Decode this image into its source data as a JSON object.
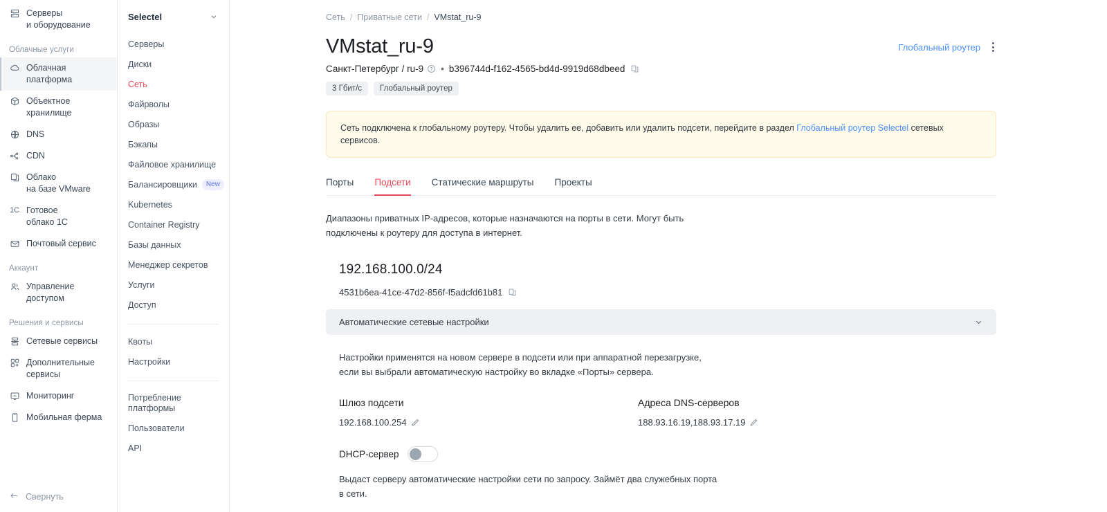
{
  "sidebar_left": {
    "top_items": [
      {
        "label": "Серверы\nи оборудование",
        "icon": "servers-icon"
      }
    ],
    "sections": [
      {
        "title": "Облачные услуги",
        "items": [
          {
            "label": "Облачная\nплатформа",
            "icon": "cloud-icon",
            "active": true
          },
          {
            "label": "Объектное\nхранилище",
            "icon": "box-icon",
            "active": false
          },
          {
            "label": "DNS",
            "icon": "globe-icon",
            "active": false
          },
          {
            "label": "CDN",
            "icon": "cdn-icon",
            "active": false
          },
          {
            "label": "Облако\nна базе VMware",
            "icon": "copy-layers-icon",
            "active": false
          },
          {
            "label": "Готовое\nоблако 1С",
            "icon": "1c-icon",
            "active": false
          },
          {
            "label": "Почтовый сервис",
            "icon": "mail-icon",
            "active": false
          }
        ]
      },
      {
        "title": "Аккаунт",
        "items": [
          {
            "label": "Управление\nдоступом",
            "icon": "users-icon",
            "active": false
          }
        ]
      },
      {
        "title": "Решения и сервисы",
        "items": [
          {
            "label": "Сетевые сервисы",
            "icon": "network-icon",
            "active": false
          },
          {
            "label": "Дополнительные\nсервисы",
            "icon": "grid-plus-icon",
            "active": false
          },
          {
            "label": "Мониторинг",
            "icon": "monitor-icon",
            "active": false
          },
          {
            "label": "Мобильная ферма",
            "icon": "phone-icon",
            "active": false
          }
        ]
      }
    ],
    "collapse_label": "Свернуть",
    "collapse_icon": "arrow-left-icon"
  },
  "sidebar_mid": {
    "project_name": "Selectel",
    "project_chevron_icon": "chevron-down-icon",
    "groups": [
      {
        "items": [
          {
            "label": "Серверы",
            "active": false
          },
          {
            "label": "Диски",
            "active": false
          },
          {
            "label": "Сеть",
            "active": true
          },
          {
            "label": "Файрволы",
            "active": false
          },
          {
            "label": "Образы",
            "active": false
          },
          {
            "label": "Бэкапы",
            "active": false
          },
          {
            "label": "Файловое хранилище",
            "active": false
          },
          {
            "label": "Балансировщики",
            "active": false,
            "badge": "New"
          },
          {
            "label": "Kubernetes",
            "active": false
          },
          {
            "label": "Container Registry",
            "active": false
          },
          {
            "label": "Базы данных",
            "active": false
          },
          {
            "label": "Менеджер секретов",
            "active": false
          },
          {
            "label": "Услуги",
            "active": false
          },
          {
            "label": "Доступ",
            "active": false
          }
        ]
      },
      {
        "items": [
          {
            "label": "Квоты",
            "active": false
          },
          {
            "label": "Настройки",
            "active": false
          }
        ]
      },
      {
        "items": [
          {
            "label": "Потребление\nплатформы",
            "active": false
          },
          {
            "label": "Пользователи",
            "active": false
          },
          {
            "label": "API",
            "active": false
          }
        ]
      }
    ]
  },
  "breadcrumb": {
    "items": [
      "Сеть",
      "Приватные сети",
      "VMstat_ru-9"
    ],
    "separator": "/"
  },
  "header": {
    "title": "VMstat_ru-9",
    "region": "Санкт-Петербург / ru-9",
    "help_icon": "question-circle-icon",
    "bullet": "•",
    "uuid": "b396744d-f162-4565-bd4d-9919d68dbeed",
    "copy_icon": "copy-icon",
    "router_link": "Глобальный роутер",
    "menu_icon": "kebab-menu-icon",
    "chips": [
      "3 Гбит/с",
      "Глобальный роутер"
    ]
  },
  "notice": {
    "text_before": "Сеть подключена к глобальному роутеру. Чтобы удалить ее, добавить или удалить подсети, перейдите в раздел ",
    "link": "Глобальный роутер Selectel",
    "text_after": " сетевых сервисов."
  },
  "tabs": [
    {
      "label": "Порты",
      "active": false
    },
    {
      "label": "Подсети",
      "active": true
    },
    {
      "label": "Статические маршруты",
      "active": false
    },
    {
      "label": "Проекты",
      "active": false
    }
  ],
  "content": {
    "lead": "Диапазоны приватных IP-адресов, которые назначаются на порты в сети. Могут быть\nподключены к роутеру для доступа в интернет.",
    "subnet_cidr": "192.168.100.0/24",
    "subnet_uuid": "4531b6ea-41ce-47d2-856f-f5adcfd61b81",
    "subnet_copy_icon": "copy-icon",
    "accordion_title": "Автоматические сетевые настройки",
    "accordion_chevron_icon": "chevron-down-icon",
    "body_note": "Настройки применятся на новом сервере в подсети или при аппаратной перезагрузке,\nесли вы выбрали автоматическую настройку во вкладке «Порты» сервера.",
    "gateway_label": "Шлюз подсети",
    "gateway_value": "192.168.100.254",
    "gateway_edit_icon": "pencil-icon",
    "dns_label": "Адреса DNS-серверов",
    "dns_value": "188.93.16.19,188.93.17.19",
    "dns_edit_icon": "pencil-icon",
    "dhcp_label": "DHCP-сервер",
    "dhcp_enabled": false,
    "dhcp_note": "Выдаст серверу автоматические настройки сети по запросу. Займёт два служебных порта\nв сети."
  },
  "colors": {
    "accent_red": "#e8485a",
    "link_blue": "#4a90ff",
    "notice_bg": "#fffbeb",
    "badge_bg": "#eceefc"
  }
}
